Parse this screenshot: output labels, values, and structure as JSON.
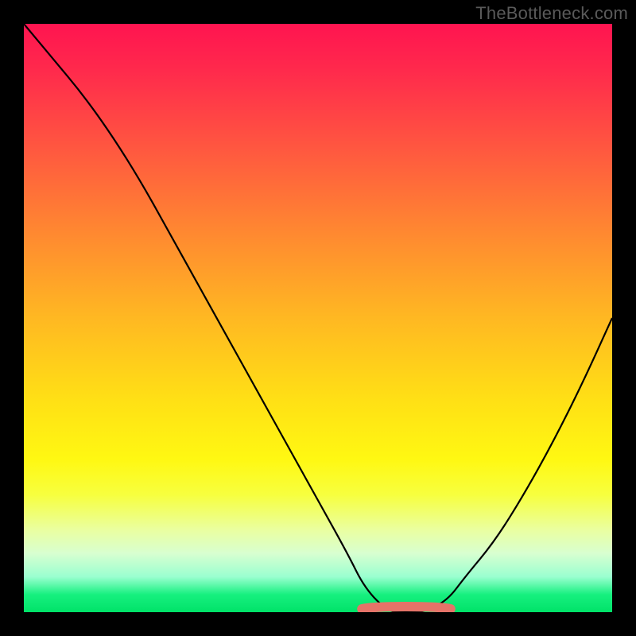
{
  "watermark": "TheBottleneck.com",
  "chart_data": {
    "type": "line",
    "title": "",
    "xlabel": "",
    "ylabel": "",
    "xlim": [
      0,
      100
    ],
    "ylim": [
      0,
      100
    ],
    "x": [
      0,
      5,
      10,
      15,
      20,
      25,
      30,
      35,
      40,
      45,
      50,
      55,
      58,
      62,
      65,
      68,
      72,
      75,
      80,
      85,
      90,
      95,
      100
    ],
    "values": [
      100,
      94,
      88,
      81,
      73,
      64,
      55,
      46,
      37,
      28,
      19,
      10,
      4,
      0,
      0,
      0,
      2,
      6,
      12,
      20,
      29,
      39,
      50
    ],
    "trough_range_x": [
      58,
      72
    ],
    "trough_marker_color": "#e57368",
    "background_gradient": {
      "top": "#ff1450",
      "mid": "#ffe015",
      "bottom": "#00e268"
    },
    "frame_color": "#000000",
    "annotations": []
  }
}
